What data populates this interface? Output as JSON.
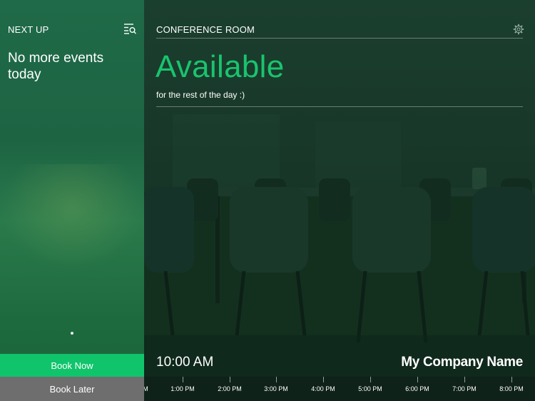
{
  "left_panel": {
    "heading": "NEXT UP",
    "message": "No more events today",
    "book_now_label": "Book Now",
    "book_later_label": "Book Later"
  },
  "room": {
    "name": "CONFERENCE ROOM",
    "status": "Available",
    "status_detail": "for the rest of the day :)"
  },
  "footer": {
    "time": "10:00 AM",
    "company": "My Company Name"
  },
  "timeline": {
    "partial_label": "M",
    "labels": [
      "1:00 PM",
      "2:00 PM",
      "3:00 PM",
      "4:00 PM",
      "5:00 PM",
      "6:00 PM",
      "7:00 PM",
      "8:00 PM"
    ]
  },
  "colors": {
    "accent": "#10c46b",
    "status": "#19c46e",
    "book_later": "#6e6e6e"
  },
  "icons": {
    "filter": "search-list-icon",
    "settings": "gear-icon"
  }
}
